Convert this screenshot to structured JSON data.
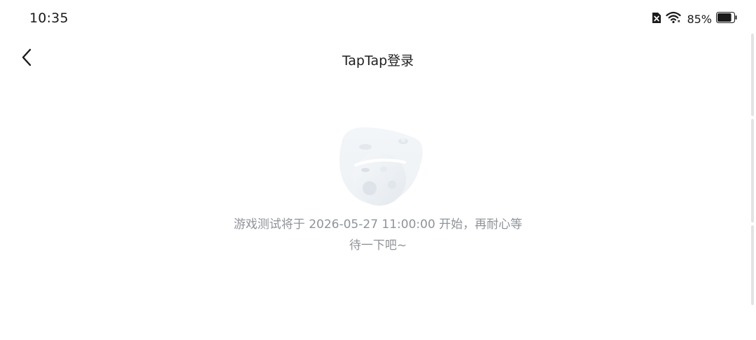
{
  "status_bar": {
    "time": "10:35",
    "battery_percent": "85%",
    "battery_level": 0.85,
    "icons": [
      "sim-blocked-icon",
      "wifi-icon",
      "battery-icon"
    ]
  },
  "header": {
    "title": "TapTap登录",
    "back_icon": "chevron-left-icon"
  },
  "content": {
    "illustration": "planet-illustration",
    "message": "游戏测试将于 2026-05-27 11:00:00 开始，再耐心等待一下吧~"
  },
  "colors": {
    "background": "#ffffff",
    "title_text": "#1f1f1f",
    "message_text": "#8f9499",
    "scrollbar": "#e3e3e3"
  }
}
